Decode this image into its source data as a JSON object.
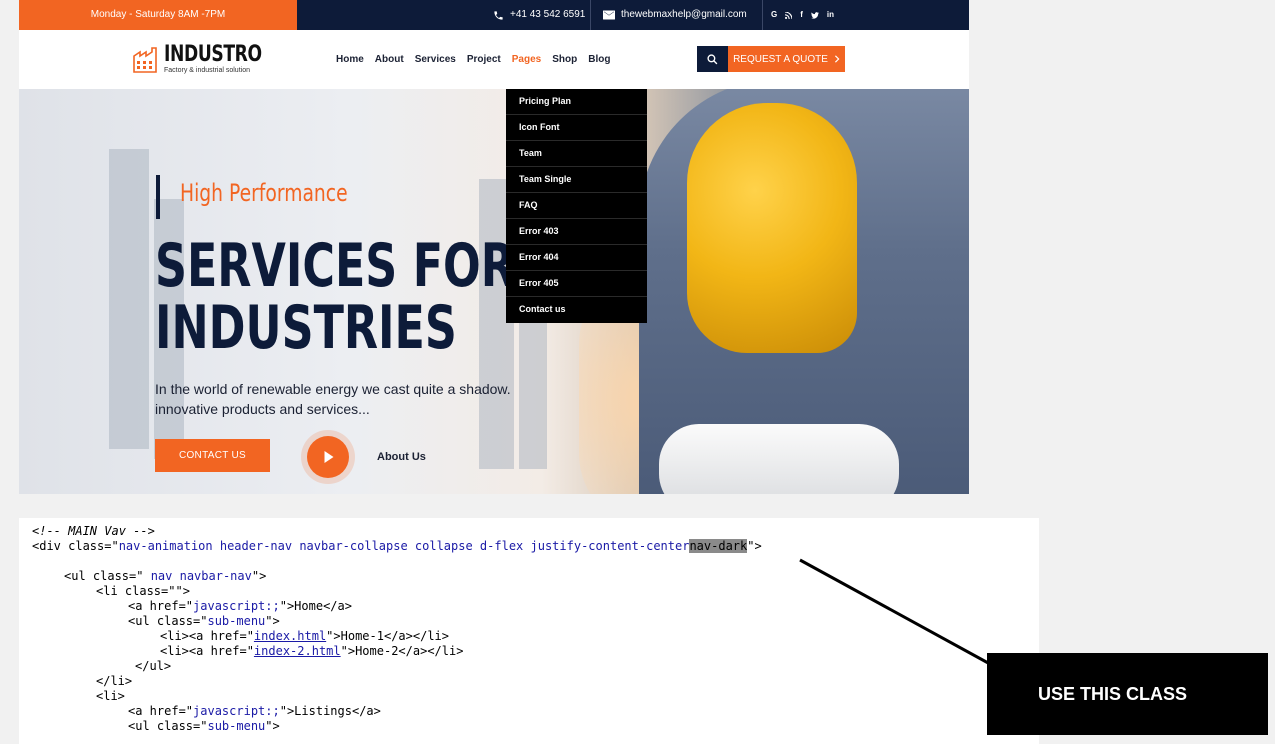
{
  "topbar": {
    "hours": "Monday - Saturday  8AM -7PM",
    "phone": "+41 43 542 6591",
    "email": "thewebmaxhelp@gmail.com",
    "social": [
      "G",
      "rss",
      "f",
      "twitter",
      "in"
    ]
  },
  "brand": {
    "name": "INDUSTRO",
    "tagline": "Factory & industrial solution"
  },
  "nav": {
    "items": [
      "Home",
      "About",
      "Services",
      "Project",
      "Pages",
      "Shop",
      "Blog"
    ],
    "active": "Pages",
    "quote_label": "REQUEST A QUOTE"
  },
  "dropdown": {
    "items": [
      "Pricing Plan",
      "Icon Font",
      "Team",
      "Team Single",
      "FAQ",
      "Error 403",
      "Error 404",
      "Error 405",
      "Contact us"
    ]
  },
  "hero": {
    "subtitle": "High Performance",
    "title_line1": "SERVICES FOR",
    "title_line2": "INDUSTRIES",
    "text_line1": "In the world of renewable energy we cast quite a shadow.",
    "text_line2": "innovative products and services...",
    "contact_label": "CONTACT US",
    "about_label": "About Us"
  },
  "code": {
    "comment": "<!-- MAIN Vav -->",
    "line2_prefix": "<div class=\"",
    "line2_classes": "nav-animation header-nav navbar-collapse collapse d-flex justify-content-center",
    "line2_highlight": "nav-dark",
    "line2_suffix": "\">",
    "ul_open": "<ul class=\"",
    "ul_classes": " nav navbar-nav",
    "quote_close": "\">",
    "li_class_open": "<li class=\"\">",
    "a_open": "<a href=\"",
    "js_href": "javascript:;",
    "home_text": "\">Home</a>",
    "submenu_open": "<ul class=\"",
    "submenu_class": "sub-menu",
    "li_a_open": "<li><a href=\"",
    "index1_href": "index.html",
    "index1_text": "\">Home-1</a></li>",
    "index2_href": "index-2.html",
    "index2_text": "\">Home-2</a></li>",
    "ul_close": "</ul>",
    "li_close": "</li>",
    "li_open": "<li>",
    "listings_text": "\">Listings</a>"
  },
  "callout": {
    "label": "USE THIS CLASS"
  },
  "colors": {
    "orange": "#f26522",
    "navy": "#0d1b39",
    "highlight": "#8a8a8a"
  }
}
